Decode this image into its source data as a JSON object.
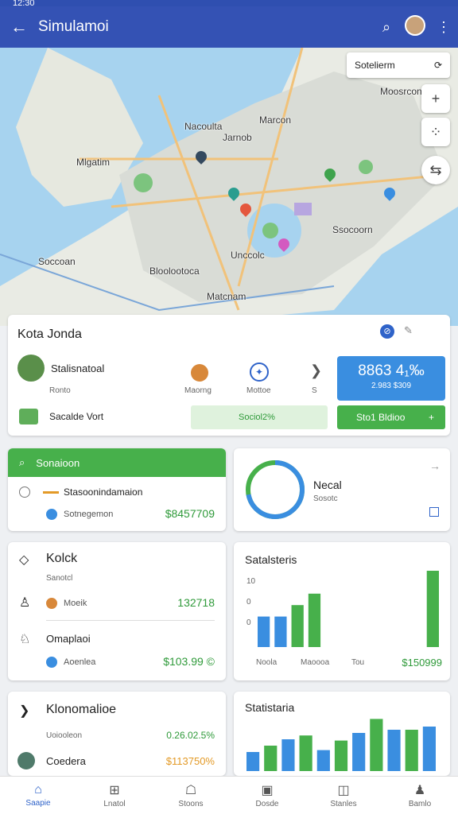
{
  "status_time": "12:30",
  "appbar": {
    "title": "Simulamoi",
    "back_icon": "←",
    "search_icon": "⌕",
    "more_icon": "⋮"
  },
  "map": {
    "search_label": "Sotelierm",
    "labels": [
      "Mlgatim",
      "Jarnob",
      "Marcon",
      "Nacoulta",
      "Moosrcon",
      "Ssocoorn",
      "Unccolc",
      "Bloolootoca",
      "Matcnam",
      "Soccoan"
    ],
    "controls": [
      "+",
      "⁘",
      "⇆"
    ]
  },
  "trip_card": {
    "title": "Kota Jonda",
    "person_name": "Stalisnatoal",
    "person_sub": "Ronto",
    "col1_label": "Maorng",
    "col2_label": "Mottoe",
    "col3_label": "S",
    "price_main": "8863 4₁‰",
    "price_sub": "2.983 $309",
    "row2_label": "Sacalde Vort",
    "progress_label": "Sociol2%",
    "action_label": "Sto1 Bldioo",
    "action_icon": "+"
  },
  "card_left1": {
    "header": "Sonaioon",
    "item1": "Stasoonindamaion",
    "item2": "Sotnegemon",
    "amount": "$8457709"
  },
  "card_right1": {
    "title": "Necal",
    "sub": "Sosotc",
    "donut_fraction": 0.72,
    "arrow": "→"
  },
  "card_left2": {
    "title": "Kolck",
    "sub": "Sanotcl",
    "row1_label": "Moeik",
    "row1_value": "132718",
    "row2_title": "Omaplaoi",
    "row3_label": "Aoenlea",
    "row3_value": "$103.99 ©"
  },
  "card_right2": {
    "title": "Satalsteris",
    "ticks": [
      "10",
      "0",
      "0"
    ],
    "categories": [
      "Noola",
      "Maoooa",
      "Tou"
    ],
    "value_label": "$150999"
  },
  "card_left3": {
    "title": "Klonomalioe",
    "sub": "Uoiooleon",
    "sub_value": "0.26.02.5%",
    "row_label": "Coedera",
    "row_value": "$113750%"
  },
  "card_right3": {
    "title": "Statistaria"
  },
  "chart_data": [
    {
      "type": "bar",
      "title": "Satalsteris",
      "categories": [
        "Noola",
        "Maoooa",
        "Tou"
      ],
      "series": [
        {
          "values": [
            4,
            4,
            5.5,
            7,
            0,
            9
          ]
        }
      ],
      "colors": [
        "#3a8ee0",
        "#3a8ee0",
        "#47b04b",
        "#47b04b",
        "#47b04b"
      ]
    },
    {
      "type": "bar",
      "title": "Statistaria",
      "series": [
        {
          "values": [
            3,
            4,
            5,
            5.6,
            3.3,
            4.8,
            6,
            8.2,
            6.5,
            6.5,
            7
          ]
        }
      ]
    }
  ],
  "nav": [
    {
      "label": "Saapie",
      "icon": "⌂"
    },
    {
      "label": "Lnatol",
      "icon": "⊞"
    },
    {
      "label": "Stoons",
      "icon": "☖"
    },
    {
      "label": "Dosde",
      "icon": "▣"
    },
    {
      "label": "Stanles",
      "icon": "◫"
    },
    {
      "label": "Bamlo",
      "icon": "♟"
    }
  ],
  "colors": {
    "primary": "#3452b4",
    "green": "#47b04b",
    "blue": "#3a8ee0",
    "orange": "#e39a27"
  }
}
